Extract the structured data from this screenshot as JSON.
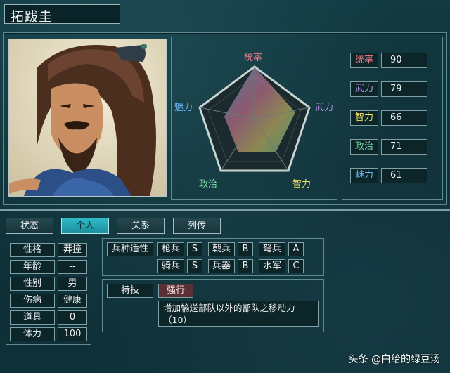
{
  "general": {
    "name": "拓跋圭"
  },
  "radar": {
    "labels": {
      "top": "统率",
      "right": "武力",
      "bottom_right": "智力",
      "bottom_left": "政治",
      "left": "魅力"
    },
    "colors": {
      "top": "#f07a8a",
      "right": "#b98cf0",
      "bottom_right": "#f0e06a",
      "bottom_left": "#7ae0a8",
      "left": "#6ab8f0"
    }
  },
  "stats": [
    {
      "label": "统率",
      "value": "90",
      "color": "#f07a8a"
    },
    {
      "label": "武力",
      "value": "79",
      "color": "#c79af5"
    },
    {
      "label": "智力",
      "value": "66",
      "color": "#f0e06a"
    },
    {
      "label": "政治",
      "value": "71",
      "color": "#7ae0a8"
    },
    {
      "label": "魅力",
      "value": "61",
      "color": "#6ab8f0"
    }
  ],
  "tabs": [
    {
      "label": "状态",
      "active": false
    },
    {
      "label": "个人",
      "active": true
    },
    {
      "label": "关系",
      "active": false
    },
    {
      "label": "列传",
      "active": false
    }
  ],
  "personal": [
    {
      "label": "性格",
      "value": "莽撞"
    },
    {
      "label": "年龄",
      "value": "--"
    },
    {
      "label": "性别",
      "value": "男"
    },
    {
      "label": "伤病",
      "value": "健康"
    },
    {
      "label": "道具",
      "value": "0"
    },
    {
      "label": "体力",
      "value": "100"
    }
  ],
  "aptitude": {
    "title": "兵种适性",
    "rows": [
      [
        {
          "type": "枪兵",
          "grade": "S"
        },
        {
          "type": "戟兵",
          "grade": "B"
        },
        {
          "type": "弩兵",
          "grade": "A"
        }
      ],
      [
        {
          "type": "骑兵",
          "grade": "S"
        },
        {
          "type": "兵器",
          "grade": "B"
        },
        {
          "type": "水军",
          "grade": "C"
        }
      ]
    ]
  },
  "skill": {
    "title": "特技",
    "name": "强行",
    "description_line1": "增加输送部队以外的部队之移动力",
    "description_line2": "（10）"
  },
  "watermark": "头条 @白给的绿豆汤"
}
